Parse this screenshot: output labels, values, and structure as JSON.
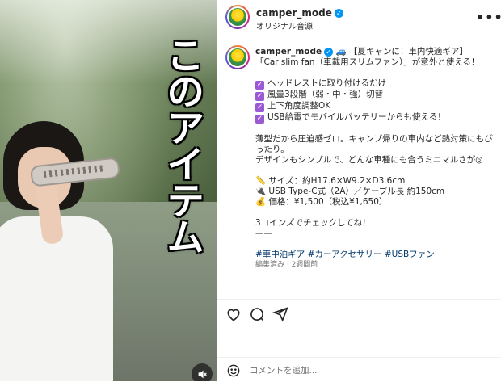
{
  "media": {
    "overlay_text": "このアイテム",
    "mute_icon": "speaker-muted-icon"
  },
  "header": {
    "username": "camper_mode",
    "audio": "オリジナル音源",
    "more_icon": "more-horizontal-icon"
  },
  "caption": {
    "username": "camper_mode",
    "title": "🚙 【夏キャンに！車内快適ギア】",
    "line2": "「Car slim fan（車載用スリムファン）」が意外と使える！",
    "checks": [
      "ヘッドレストに取り付けるだけ",
      "風量3段階（弱・中・強）切替",
      "上下角度調整OK",
      "USB給電でモバイルバッテリーからも使える！"
    ],
    "para1": "薄型だから圧迫感ゼロ。キャンプ帰りの車内など熱対策にもぴったり。",
    "para2": "デザインもシンプルで、どんな車種にも合うミニマルさが◎",
    "spec_size": "📏 サイズ：約H17.6×W9.2×D3.6cm",
    "spec_usb": "🔌 USB Type-C式（2A）／ケーブル長 約150cm",
    "spec_price": "💰 価格：¥1,500（税込¥1,650）",
    "cta": "3コインズでチェックしてね！",
    "divider": "——",
    "hashtags": [
      "#車中泊ギア",
      "#カーアクセサリー",
      "#USBファン"
    ],
    "meta": "編集済み · 2週間前"
  },
  "actions": {
    "icons": [
      "heart-icon",
      "comment-icon",
      "share-icon"
    ]
  },
  "comment": {
    "placeholder": "コメントを追加...",
    "emoji_icon": "emoji-icon"
  },
  "colors": {
    "link": "#00376b",
    "verified": "#0095f6",
    "check": "#9b59d6"
  }
}
